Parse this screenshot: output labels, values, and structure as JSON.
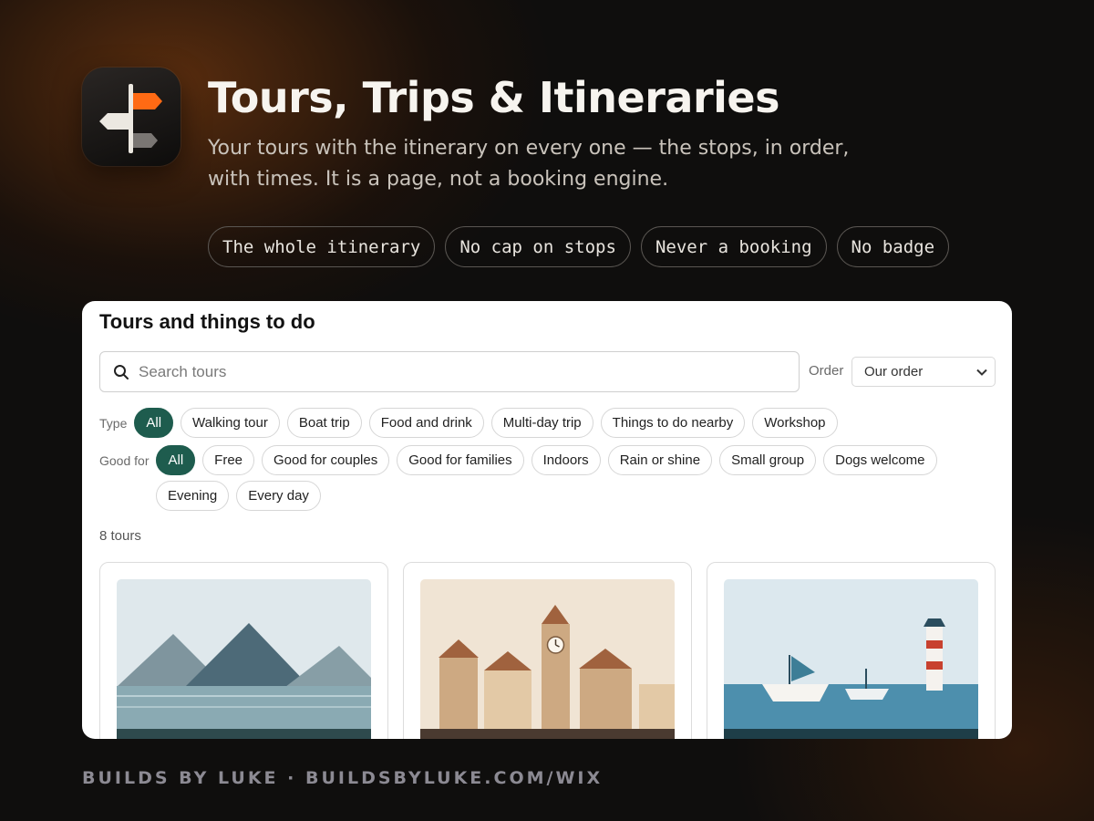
{
  "hero": {
    "title": "Tours, Trips & Itineraries",
    "subtitle": "Your tours with the itinerary on every one — the stops, in order, with times. It is a page, not a booking engine.",
    "app_icon": "signpost-icon",
    "feature_pills": [
      "The whole itinerary",
      "No cap on stops",
      "Never a booking",
      "No badge"
    ]
  },
  "widget": {
    "title": "Tours and things to do",
    "search": {
      "placeholder": "Search tours",
      "value": "",
      "icon": "search-icon"
    },
    "order": {
      "label": "Order",
      "selected": "Our order",
      "icon": "chevron-down-icon"
    },
    "type_filter": {
      "label": "Type",
      "active": "All",
      "options": [
        "All",
        "Walking tour",
        "Boat trip",
        "Food and drink",
        "Multi-day trip",
        "Things to do nearby",
        "Workshop"
      ]
    },
    "good_for_filter": {
      "label": "Good for",
      "active": "All",
      "options": [
        "All",
        "Free",
        "Good for couples",
        "Good for families",
        "Indoors",
        "Rain or shine",
        "Small group",
        "Dogs welcome",
        "Evening",
        "Every day"
      ]
    },
    "result_count": "8 tours",
    "tour_cards": [
      {
        "image": "mountain-lake-illustration"
      },
      {
        "image": "old-town-clocktower-illustration"
      },
      {
        "image": "harbour-lighthouse-illustration"
      }
    ],
    "accent_color": "#1e5c4e"
  },
  "footer": {
    "text": "BUILDS BY LUKE · BUILDSBYLUKE.COM/WIX"
  }
}
